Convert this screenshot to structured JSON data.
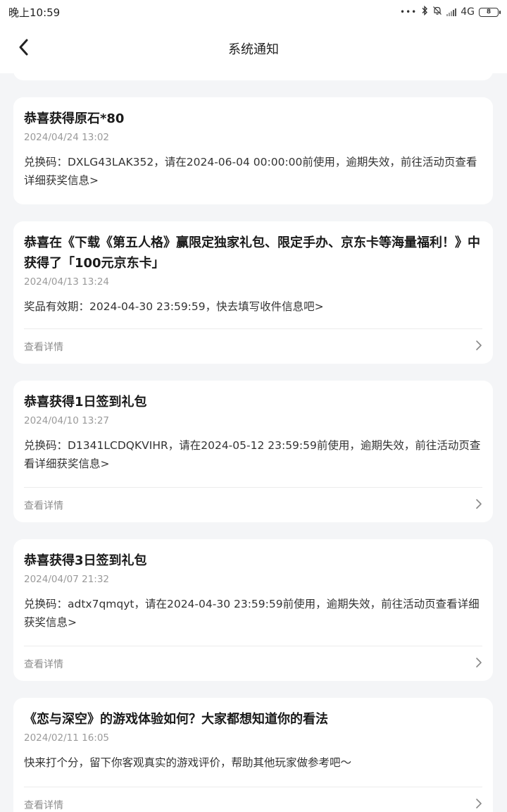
{
  "status_bar": {
    "time": "晚上10:59",
    "dots": "•••",
    "network": "4G",
    "battery": "8"
  },
  "header": {
    "title": "系统通知"
  },
  "notifications": [
    {
      "title": "恭喜获得原石*80",
      "date": "2024/04/24 13:02",
      "body": "兑换码：DXLG43LAK352，请在2024-06-04 00:00:00前使用，逾期失效，前往活动页查看详细获奖信息>"
    },
    {
      "title": "恭喜在《下载《第五人格》赢限定独家礼包、限定手办、京东卡等海量福利！》中获得了「100元京东卡」",
      "date": "2024/04/13 13:24",
      "body": "奖品有效期：2024-04-30 23:59:59，快去填写收件信息吧>",
      "footer": "查看详情"
    },
    {
      "title": "恭喜获得1日签到礼包",
      "date": "2024/04/10 13:27",
      "body": "兑换码：D1341LCDQKVIHR，请在2024-05-12 23:59:59前使用，逾期失效，前往活动页查看详细获奖信息>",
      "footer": "查看详情"
    },
    {
      "title": "恭喜获得3日签到礼包",
      "date": "2024/04/07 21:32",
      "body": "兑换码：adtx7qmqyt，请在2024-04-30 23:59:59前使用，逾期失效，前往活动页查看详细获奖信息>",
      "footer": "查看详情"
    },
    {
      "title": "《恋与深空》的游戏体验如何？大家都想知道你的看法",
      "date": "2024/02/11 16:05",
      "body": "快来打个分，留下你客观真实的游戏评价，帮助其他玩家做参考吧～",
      "footer": "查看详情"
    }
  ],
  "icons": {
    "back": "chevron-left-icon",
    "footer_arrow": "chevron-right-icon"
  }
}
